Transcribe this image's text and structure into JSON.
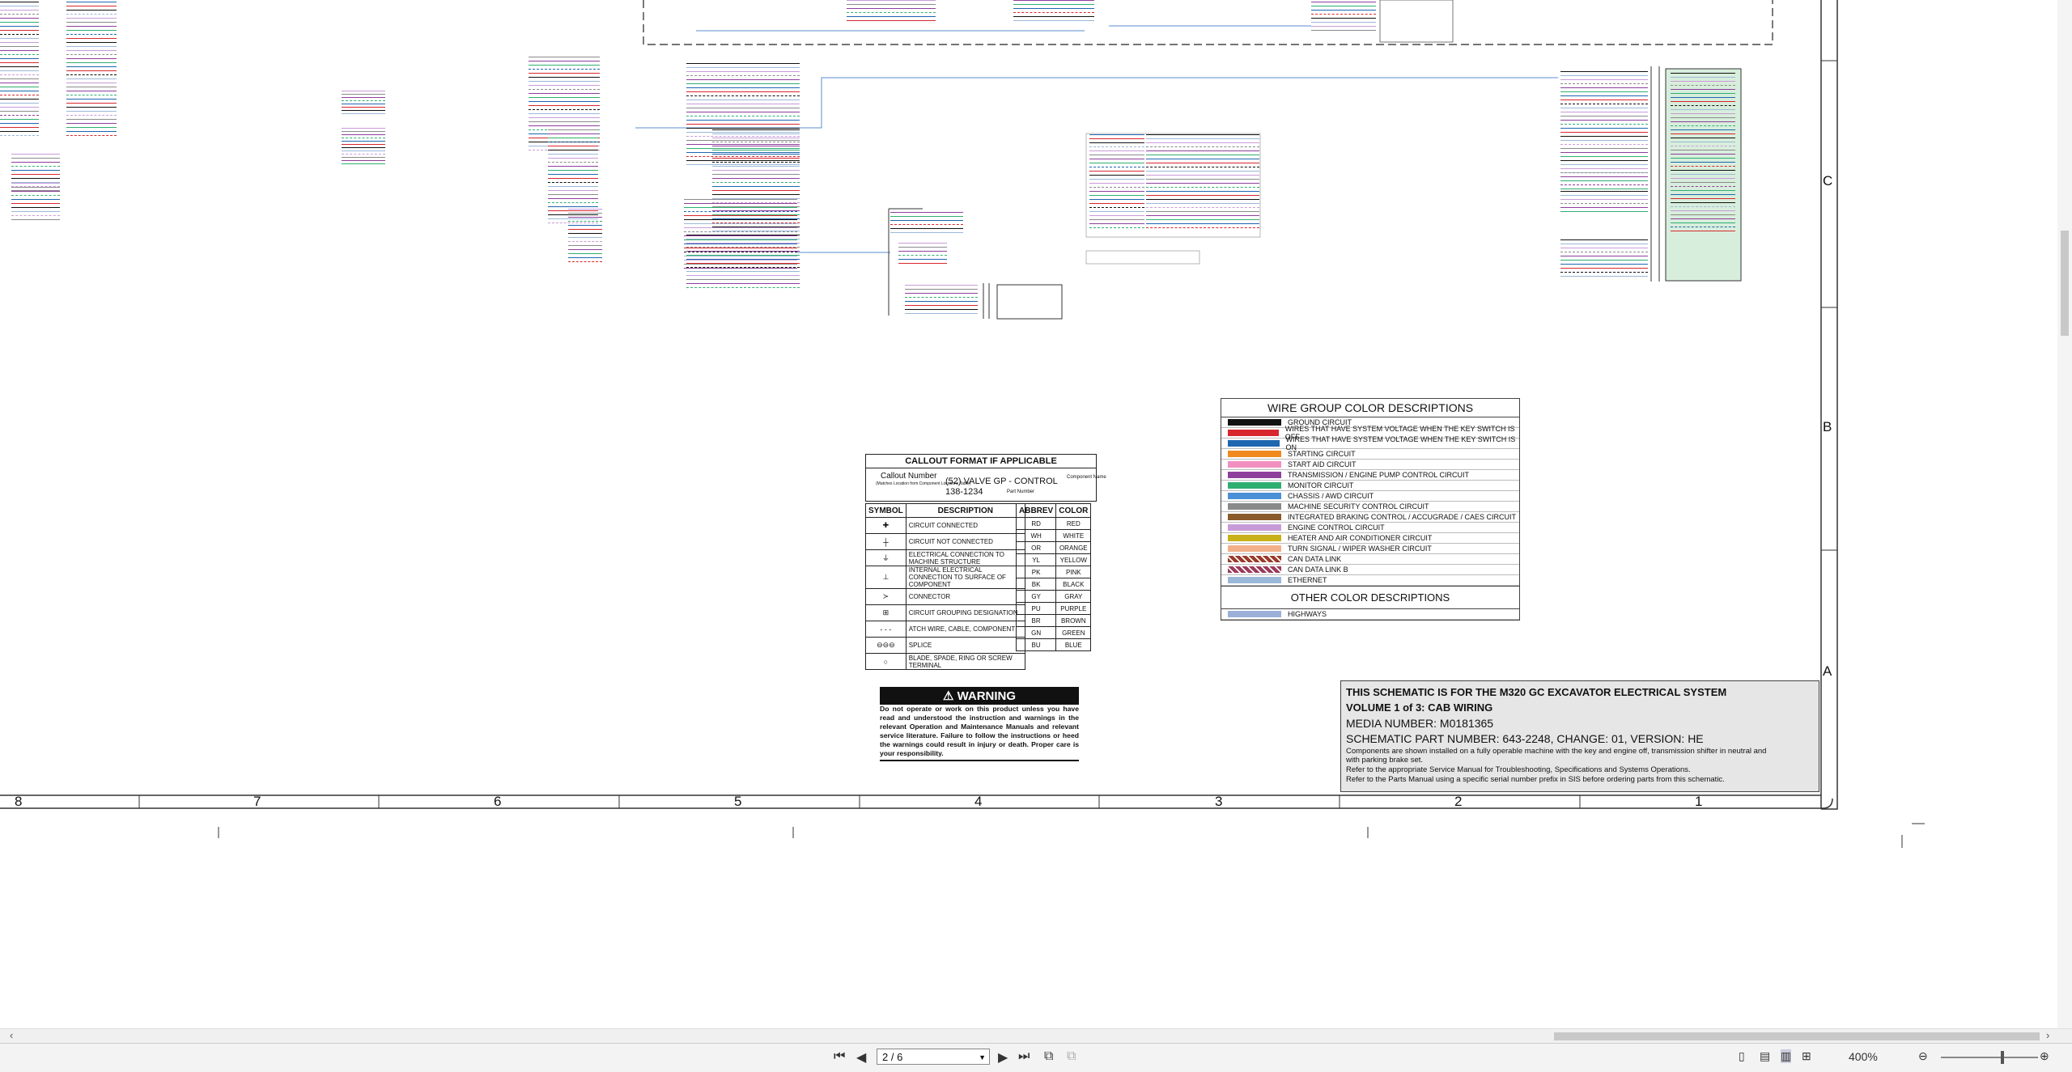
{
  "zones": {
    "columns": [
      "8",
      "7",
      "6",
      "5",
      "4",
      "3",
      "2",
      "1"
    ],
    "rows": [
      "C",
      "B",
      "A"
    ]
  },
  "callout": {
    "title": "CALLOUT FORMAT IF APPLICABLE",
    "callout_number": "Callout Number",
    "callout_note": "(Matches Location from Component Locations Table)",
    "component": "(52) VALVE GP - CONTROL",
    "part_number": "138-1234",
    "component_name": "Component Name",
    "part_label": "Part Number"
  },
  "symbols": {
    "headers": [
      "SYMBOL",
      "DESCRIPTION"
    ],
    "rows": [
      {
        "glyph": "✚",
        "desc": "CIRCUIT CONNECTED"
      },
      {
        "glyph": "┼",
        "desc": "CIRCUIT NOT CONNECTED"
      },
      {
        "glyph": "⏚",
        "desc": "ELECTRICAL CONNECTION TO MACHINE STRUCTURE"
      },
      {
        "glyph": "⊥",
        "desc": "INTERNAL ELECTRICAL CONNECTION TO SURFACE OF COMPONENT"
      },
      {
        "glyph": "≻",
        "desc": "CONNECTOR"
      },
      {
        "glyph": "⊞",
        "desc": "CIRCUIT GROUPING DESIGNATION"
      },
      {
        "glyph": "- - -",
        "desc": "ATCH WIRE, CABLE, COMPONENT"
      },
      {
        "glyph": "⊖⊖⊖",
        "desc": "SPLICE"
      },
      {
        "glyph": "○",
        "desc": "BLADE, SPADE, RING OR SCREW TERMINAL"
      }
    ]
  },
  "abbrev": {
    "headers": [
      "ABBREV",
      "COLOR"
    ],
    "rows": [
      [
        "RD",
        "RED"
      ],
      [
        "WH",
        "WHITE"
      ],
      [
        "OR",
        "ORANGE"
      ],
      [
        "YL",
        "YELLOW"
      ],
      [
        "PK",
        "PINK"
      ],
      [
        "BK",
        "BLACK"
      ],
      [
        "GY",
        "GRAY"
      ],
      [
        "PU",
        "PURPLE"
      ],
      [
        "BR",
        "BROWN"
      ],
      [
        "GN",
        "GREEN"
      ],
      [
        "BU",
        "BLUE"
      ]
    ]
  },
  "wire_groups": {
    "title": "WIRE GROUP COLOR DESCRIPTIONS",
    "rows": [
      {
        "color": "#111111",
        "label": "GROUND CIRCUIT"
      },
      {
        "color": "#d8262e",
        "label": "WIRES THAT HAVE SYSTEM VOLTAGE WHEN THE KEY SWITCH IS OFF"
      },
      {
        "color": "#1f66b0",
        "label": "WIRES THAT HAVE SYSTEM VOLTAGE WHEN THE KEY SWITCH IS ON"
      },
      {
        "color": "#f08a1e",
        "label": "STARTING CIRCUIT"
      },
      {
        "color": "#f28fc0",
        "label": "START AID CIRCUIT"
      },
      {
        "color": "#8e3f9c",
        "label": "TRANSMISSION / ENGINE PUMP CONTROL CIRCUIT"
      },
      {
        "color": "#2fae72",
        "label": "MONITOR CIRCUIT"
      },
      {
        "color": "#4b8fd6",
        "label": "CHASSIS / AWD CIRCUIT"
      },
      {
        "color": "#8a8a8a",
        "label": "MACHINE SECURITY CONTROL CIRCUIT"
      },
      {
        "color": "#8a5a2a",
        "label": "INTEGRATED BRAKING CONTROL / ACCUGRADE / CAES CIRCUIT"
      },
      {
        "color": "#c89bd8",
        "label": "ENGINE CONTROL CIRCUIT"
      },
      {
        "color": "#c8b018",
        "label": "HEATER AND AIR CONDITIONER CIRCUIT"
      },
      {
        "color": "#f2b08a",
        "label": "TURN SIGNAL / WIPER WASHER CIRCUIT"
      },
      {
        "color": "#9a3a2a",
        "label": "CAN DATA LINK"
      },
      {
        "color": "#9a3a5a",
        "label": "CAN DATA LINK B"
      },
      {
        "color": "#9ab8d8",
        "label": "ETHERNET"
      }
    ],
    "other_title": "OTHER COLOR DESCRIPTIONS",
    "other_rows": [
      {
        "color": "#9ab0d8",
        "label": "HIGHWAYS"
      }
    ]
  },
  "warning": {
    "title": "WARNING",
    "body": "Do not operate or work on this product unless you have read and understood the instruction and warnings in the relevant Operation and Maintenance Manuals and relevant service literature. Failure to follow the instructions or heed the warnings could result in injury or death. Proper care is your responsibility."
  },
  "title_block": {
    "line1": "THIS SCHEMATIC IS FOR THE M320 GC EXCAVATOR ELECTRICAL SYSTEM",
    "line2": "VOLUME 1 of 3: CAB WIRING",
    "line3": "MEDIA NUMBER: M0181365",
    "line4": "SCHEMATIC PART NUMBER: 643-2248, CHANGE: 01, VERSION: HE",
    "line5": "Components are shown installed on a fully operable machine with the key and engine off, transmission shifter in neutral and with parking brake set.",
    "line6": "Refer to the appropriate Service Manual for Troubleshooting, Specifications and Systems Operations.",
    "line7": "Refer to the Parts Manual using a specific serial number prefix in SIS before ordering parts from this schematic."
  },
  "viewer": {
    "page_field": "2 / 6",
    "zoom": "400%"
  }
}
